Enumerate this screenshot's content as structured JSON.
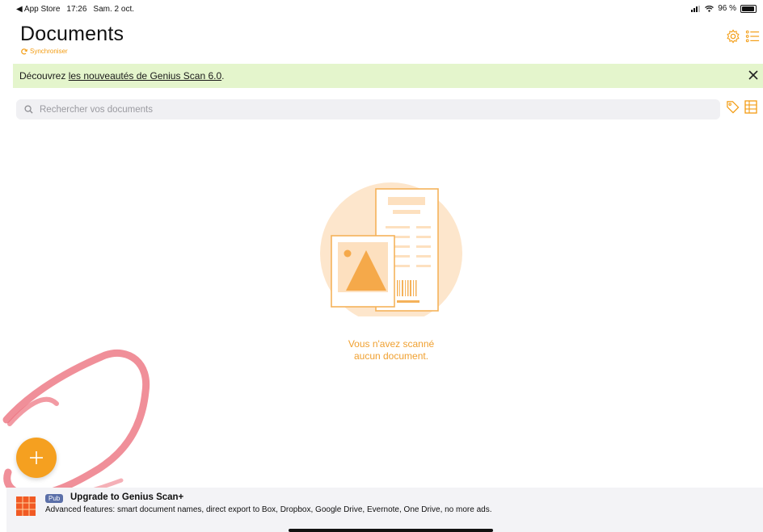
{
  "status_bar": {
    "back_app": "◀ App Store",
    "time": "17:26",
    "date": "Sam. 2 oct.",
    "battery": "96 %",
    "battery_level": 0.96
  },
  "header": {
    "title": "Documents",
    "sync_label": "Synchroniser"
  },
  "banner": {
    "prefix": "Découvrez ",
    "link_text": "les nouveautés de Genius Scan 6.0",
    "suffix": ".",
    "close_icon": "×"
  },
  "search": {
    "placeholder": "Rechercher vos documents"
  },
  "empty_state": {
    "line1": "Vous n'avez scanné",
    "line2": "aucun document."
  },
  "fab": {
    "icon": "+"
  },
  "ad": {
    "badge": "Pub",
    "title": "Upgrade to Genius Scan+",
    "description": "Advanced features: smart document names, direct export to Box, Dropbox, Google Drive, Evernote, One Drive, no more ads."
  },
  "colors": {
    "accent": "#f5a020",
    "banner_bg": "#e4f5cc",
    "annotation": "#ec6f7c"
  }
}
